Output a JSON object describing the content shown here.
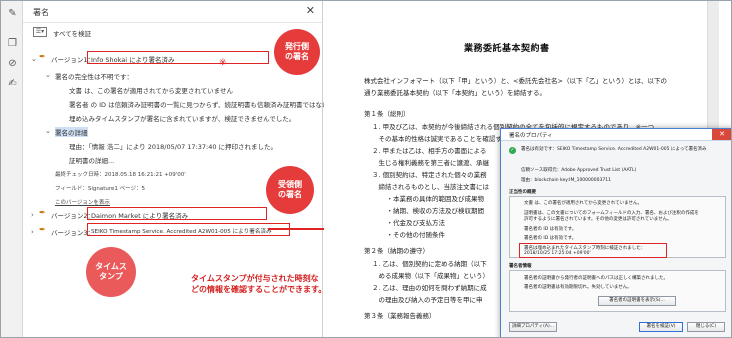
{
  "panel": {
    "title": "署名",
    "verify_all": "すべてを検証",
    "sig1": {
      "prefix": "バージョン1：",
      "name": "Info Shokai により署名済み",
      "integrity": "署名の完全性は不明です：",
      "line1": "文書 は、この署名が適用されてから変更されていません",
      "line2": "署名者 の ID は信頼済み証明書の一覧に見つからず、続証明書も信頼済み証明書ではない",
      "line3": "埋め込みタイムスタンプが署名に含まれていますが、検証できませんでした。",
      "details_label": "署名の詳細",
      "reason": "理由：「情報 浩二」により 2018/05/07 17:37:40 に押印されました。",
      "cert_details": "証明書の詳細...",
      "last_check": "最終チェック日時：2018.05.18 16:21:21 +09'00'",
      "field": "フィールド：Signature1 ページ：5",
      "show_version": "このバージョンを表示"
    },
    "sig2": {
      "prefix": "バージョン2：",
      "name": "Daimon Market により署名済み"
    },
    "sig3": {
      "prefix": "バージョン3：",
      "name": "SEIKO Timestamp Service. Accredited A2W01-005 により署名済み"
    }
  },
  "annotations": {
    "sender": "発行側の署名",
    "receiver": "受領側の署名",
    "timestamp": "タイムスタンプ",
    "note_line1": "タイムスタンプが付与された時刻な",
    "note_line2": "どの情報を確認することができます。"
  },
  "doc": {
    "title": "業務委託基本契約書",
    "lines": [
      "株式会社インフォマート（以下「甲」という）と、<委託先会社名>（以下「乙」という）とは、以下の",
      "通り業務委託基本契約（以下「本契約」という）を締結する。",
      "第１条（総則）",
      "１. 甲及び乙は、本契約が今後締結される個別契約の全てを包括的に規定するものであり、※一つ、",
      "　その基本的性格は誠実であることを確認する。",
      "２. 甲または乙は、相手方の書面による",
      "　生じる権利義務を第三者に譲渡、承継",
      "３. 個別契約は、特定された個々の業務",
      "　締結されるものとし、当該注文書には",
      "　・本業務の具体的範囲及び成果物",
      "　・納期、検収の方法及び検収期間",
      "　・代金及び支払方法",
      "　・その他の付随条件",
      "第２条（納期の遵守）",
      "１. 乙は、個別契約に定める納期（以下",
      "　める成果物（以下「成果物」という）",
      "２. 乙は、理由の如何を問わず納期に成",
      "　の理由及び納入の予定日等を甲に申",
      "第３条（業務報告義務）"
    ]
  },
  "dialog": {
    "title": "署名のプロパティ",
    "status": "署名は有効です：SEIKO Timestamp Service. Accredited A2W01-005 によって署名済み",
    "trust_source": "信頼ソース取得元：Adobe Approved Trust List (AATL)",
    "signing_time": "理由：blockchain key:IM_100000003711",
    "summary_header": "正当性の概要",
    "summary1": "文書 は、この署名が適用されてから変更されていません。",
    "summary2": "証明書は、この文書についてのフォームフィールドの入力、署名、および注釈の作成を",
    "summary3": "許可するように署名されています。その他の変更は許可されていません。",
    "valid_identity": "署名者の ID は有効です。",
    "valid_id2": "署名者の ID は有効です。",
    "ts_line1": "署名は埋め込まれたタイムスタンプ時刻に検証されました：",
    "ts_line2": "2018/10/25 17:25:04 +09'00'",
    "signer_info_header": "署名者情報",
    "signer1": "署名者の証明書から発行者の証明書へのパスは正しく構築されました。",
    "signer2": "署名者の証明書は有効期限切れ。失効していません。",
    "show_cert_button": "署名者の証明書を表示(S)...",
    "detail_button": "詳細プロパティ(A)...",
    "validate_button": "署名を検証(V)",
    "close_button": "閉じる(C)"
  }
}
